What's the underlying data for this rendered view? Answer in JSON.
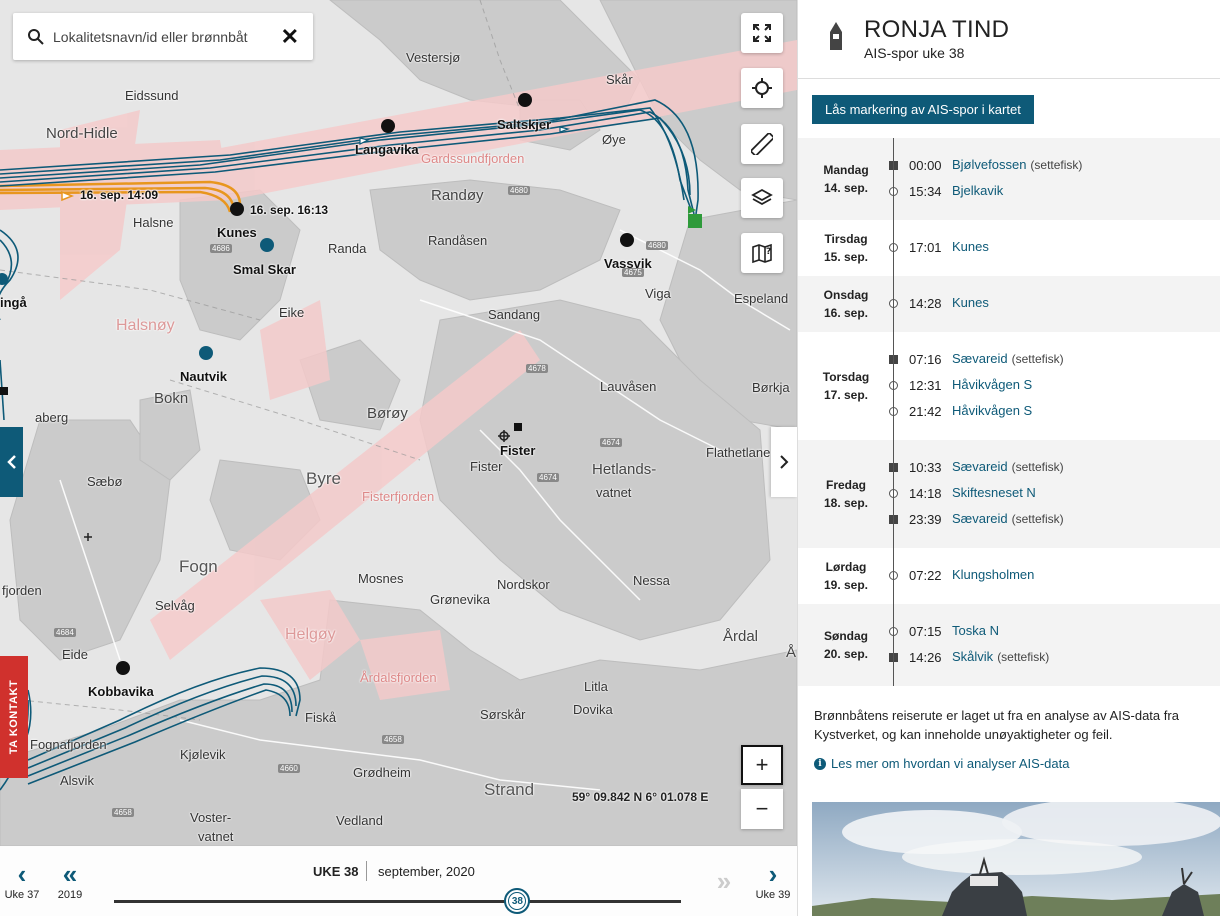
{
  "search": {
    "placeholder": "Lokalitetsnavn/id eller brønnbåt"
  },
  "map": {
    "places": [
      {
        "text": "Vestersjø",
        "cls": ""
      },
      {
        "text": "Skår",
        "cls": ""
      },
      {
        "text": "Eidssund",
        "cls": ""
      },
      {
        "text": "Nord-Hidle",
        "cls": "mid"
      },
      {
        "text": "Gardssundfjorden",
        "cls": "sea"
      },
      {
        "text": "Øye",
        "cls": ""
      },
      {
        "text": "Randøy",
        "cls": "mid"
      },
      {
        "text": "Halsne",
        "cls": ""
      },
      {
        "text": "Randåsen",
        "cls": ""
      },
      {
        "text": "Randa",
        "cls": ""
      },
      {
        "text": "Viga",
        "cls": ""
      },
      {
        "text": "Espeland",
        "cls": ""
      },
      {
        "text": "Eike",
        "cls": ""
      },
      {
        "text": "Sandang",
        "cls": ""
      },
      {
        "text": "Halsnøy",
        "cls": "sea-big"
      },
      {
        "text": "Bokn",
        "cls": "mid"
      },
      {
        "text": "Lauvåsen",
        "cls": ""
      },
      {
        "text": "Børkja",
        "cls": ""
      },
      {
        "text": "Børøy",
        "cls": "mid"
      },
      {
        "text": "aberg",
        "cls": ""
      },
      {
        "text": "Flathetlane",
        "cls": ""
      },
      {
        "text": "Hetlands-",
        "cls": "mid"
      },
      {
        "text": "vatnet",
        "cls": ""
      },
      {
        "text": "Byre",
        "cls": "big"
      },
      {
        "text": "Fister",
        "cls": ""
      },
      {
        "text": "Sæbø",
        "cls": ""
      },
      {
        "text": "Fisterfjorden",
        "cls": "sea"
      },
      {
        "text": "Fogn",
        "cls": "big"
      },
      {
        "text": "fjorden",
        "cls": ""
      },
      {
        "text": "Mosnes",
        "cls": ""
      },
      {
        "text": "Nordskor",
        "cls": ""
      },
      {
        "text": "Nessa",
        "cls": ""
      },
      {
        "text": "Selvåg",
        "cls": ""
      },
      {
        "text": "Grønevika",
        "cls": ""
      },
      {
        "text": "Helgøy",
        "cls": "sea-big"
      },
      {
        "text": "Årdal",
        "cls": "mid"
      },
      {
        "text": "Eide",
        "cls": ""
      },
      {
        "text": "Årdalsfjorden",
        "cls": "sea"
      },
      {
        "text": "Litla",
        "cls": ""
      },
      {
        "text": "Dovika",
        "cls": ""
      },
      {
        "text": "Fiskå",
        "cls": ""
      },
      {
        "text": "Sørskår",
        "cls": ""
      },
      {
        "text": "Fognafjorden",
        "cls": ""
      },
      {
        "text": "Kjølevik",
        "cls": ""
      },
      {
        "text": "Alsvik",
        "cls": ""
      },
      {
        "text": "Grødheim",
        "cls": ""
      },
      {
        "text": "Strand",
        "cls": "big"
      },
      {
        "text": "Voster-",
        "cls": ""
      },
      {
        "text": "vatnet",
        "cls": ""
      },
      {
        "text": "Vedland",
        "cls": ""
      },
      {
        "text": "Å",
        "cls": "mid"
      },
      {
        "text": "ingå",
        "cls": "bold"
      }
    ],
    "sites": [
      {
        "text": "Saltskjer"
      },
      {
        "text": "Langavika"
      },
      {
        "text": "Kunes"
      },
      {
        "text": "Smal Skar"
      },
      {
        "text": "Vassvik"
      },
      {
        "text": "Nautvik"
      },
      {
        "text": "Fister"
      },
      {
        "text": "Kobbavika"
      }
    ],
    "track_labels": [
      {
        "text": "16. sep. 14:09"
      },
      {
        "text": "16. sep. 16:13"
      }
    ],
    "road_numbers": [
      "4680",
      "4680",
      "4686",
      "4675",
      "4678",
      "4674",
      "4674",
      "4684",
      "4658",
      "4660",
      "4658"
    ],
    "coords": "59° 09.842 N 6° 01.078 E",
    "colors": {
      "water": "#e6e6e6",
      "land": "#c9c9c9",
      "shipping_lane": "#f4caca",
      "track_blue": "#0e5a78",
      "track_orange": "#e8961e",
      "accent": "#0e5a78",
      "contact": "#d0312d"
    },
    "tools": [
      "fullscreen-icon",
      "locate-icon",
      "ruler-icon",
      "layers-icon",
      "map-help-icon"
    ],
    "zoom_in": "+",
    "zoom_out": "−",
    "contact_label": "TA KONTAKT"
  },
  "timeline": {
    "prev_week": "Uke 37",
    "prev_year": "2019",
    "next_week": "Uke 39",
    "week_label": "UKE 38",
    "month_label": "september, 2020",
    "knob_value": "38",
    "week_number": 38,
    "weeks_in_year": 53
  },
  "panel": {
    "boat_name": "RONJA TIND",
    "subtitle": "AIS-spor uke 38",
    "lock_button": "Lås markering av AIS-spor i kartet",
    "days": [
      {
        "day": "Mandag",
        "date": "14. sep.",
        "events": [
          {
            "time": "00:00",
            "loc": "Bjølvefossen",
            "note": "(settefisk)",
            "mark": "sq"
          },
          {
            "time": "15:34",
            "loc": "Bjelkavik",
            "note": "",
            "mark": "dot"
          }
        ]
      },
      {
        "day": "Tirsdag",
        "date": "15. sep.",
        "events": [
          {
            "time": "17:01",
            "loc": "Kunes",
            "note": "",
            "mark": "dot"
          }
        ]
      },
      {
        "day": "Onsdag",
        "date": "16. sep.",
        "events": [
          {
            "time": "14:28",
            "loc": "Kunes",
            "note": "",
            "mark": "dot"
          }
        ]
      },
      {
        "day": "Torsdag",
        "date": "17. sep.",
        "events": [
          {
            "time": "07:16",
            "loc": "Sævareid",
            "note": "(settefisk)",
            "mark": "sq"
          },
          {
            "time": "12:31",
            "loc": "Håvikvågen S",
            "note": "",
            "mark": "dot"
          },
          {
            "time": "21:42",
            "loc": "Håvikvågen S",
            "note": "",
            "mark": "dot"
          }
        ]
      },
      {
        "day": "Fredag",
        "date": "18. sep.",
        "events": [
          {
            "time": "10:33",
            "loc": "Sævareid",
            "note": "(settefisk)",
            "mark": "sq"
          },
          {
            "time": "14:18",
            "loc": "Skiftesneset N",
            "note": "",
            "mark": "dot"
          },
          {
            "time": "23:39",
            "loc": "Sævareid",
            "note": "(settefisk)",
            "mark": "sq"
          }
        ]
      },
      {
        "day": "Lørdag",
        "date": "19. sep.",
        "events": [
          {
            "time": "07:22",
            "loc": "Klungsholmen",
            "note": "",
            "mark": "dot"
          }
        ]
      },
      {
        "day": "Søndag",
        "date": "20. sep.",
        "events": [
          {
            "time": "07:15",
            "loc": "Toska N",
            "note": "",
            "mark": "dot"
          },
          {
            "time": "14:26",
            "loc": "Skålvik",
            "note": "(settefisk)",
            "mark": "sq"
          }
        ]
      }
    ],
    "disclaimer": "Brønnbåtens reiserute er laget ut fra en analyse av AIS-data fra Kystverket, og kan inneholde unøyaktigheter og feil.",
    "learn_more": "Les mer om hvordan vi analyser AIS-data"
  }
}
